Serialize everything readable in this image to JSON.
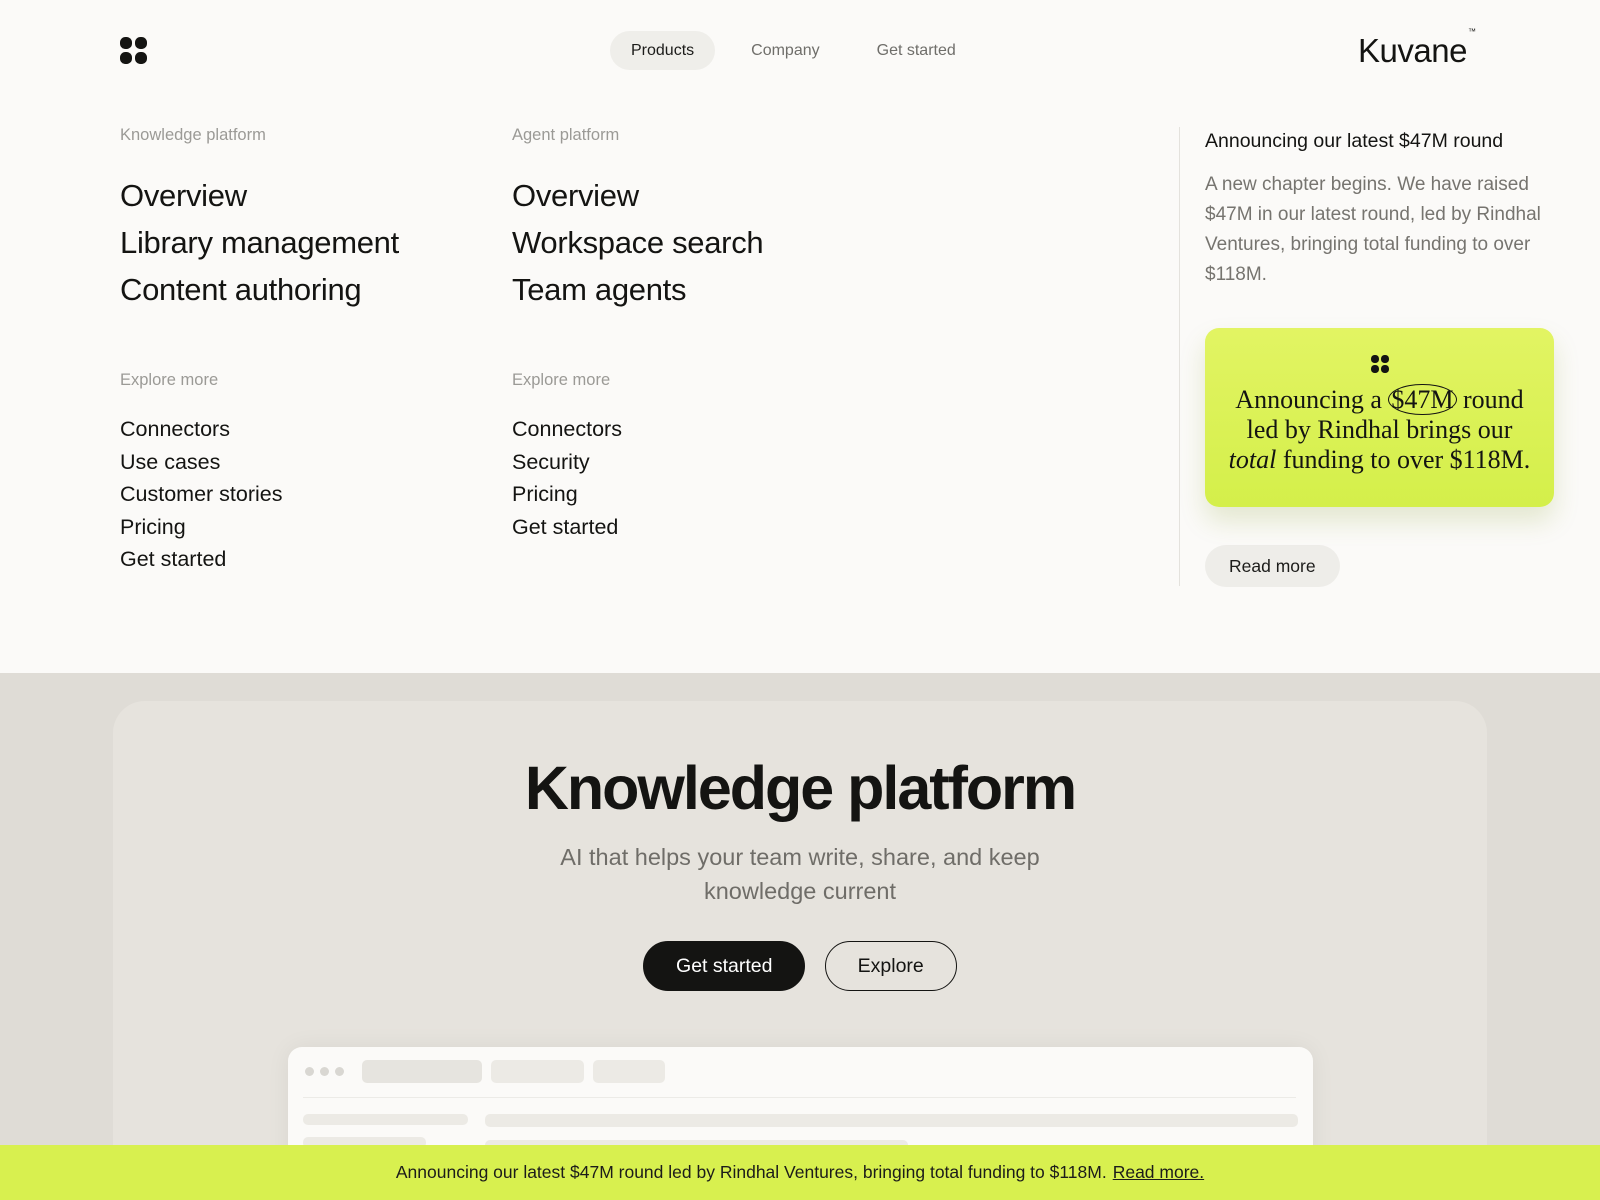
{
  "brand": {
    "name": "Kuvane",
    "trademark": "™",
    "logo_icon": "four-dots-logo-icon"
  },
  "nav": {
    "items": [
      {
        "label": "Products",
        "active": true
      },
      {
        "label": "Company",
        "active": false
      },
      {
        "label": "Get started",
        "active": false
      }
    ]
  },
  "menu": {
    "knowledge": {
      "heading": "Knowledge platform",
      "primary": [
        "Overview",
        "Library management",
        "Content authoring"
      ],
      "explore_heading": "Explore more",
      "secondary": [
        "Connectors",
        "Use cases",
        "Customer stories",
        "Pricing",
        "Get started"
      ]
    },
    "agent": {
      "heading": "Agent platform",
      "primary": [
        "Overview",
        "Workspace search",
        "Team agents"
      ],
      "explore_heading": "Explore more",
      "secondary": [
        "Connectors",
        "Security",
        "Pricing",
        "Get started"
      ]
    }
  },
  "news": {
    "title": "Announcing our latest $47M round",
    "body": "A new chapter begins. We have raised $47M in our latest round, led by Rindhal Ventures, bringing total funding to over $118M.",
    "card": {
      "line1_pre": "Announcing a",
      "line1_circled": "$47M",
      "line1_post": "round",
      "line2": "led by Rindhal brings our",
      "line3_italic": "total",
      "line3_post": "funding to over $118M.",
      "background": "#d8f04f"
    },
    "read_more": "Read more"
  },
  "hero": {
    "title": "Knowledge platform",
    "subtitle": "AI that helps your team write, share, and keep knowledge current",
    "primary_cta": "Get started",
    "secondary_cta": "Explore"
  },
  "announcement": {
    "text": "Announcing our latest $47M round led by Rindhal Ventures, bringing total funding to $118M.",
    "link": "Read more.",
    "background": "#d8f04f"
  },
  "colors": {
    "accent": "#d8f04f",
    "text": "#141412",
    "muted": "#9b9a96",
    "page_bg": "#fbfaf8",
    "section_bg": "#dfdcd6"
  }
}
